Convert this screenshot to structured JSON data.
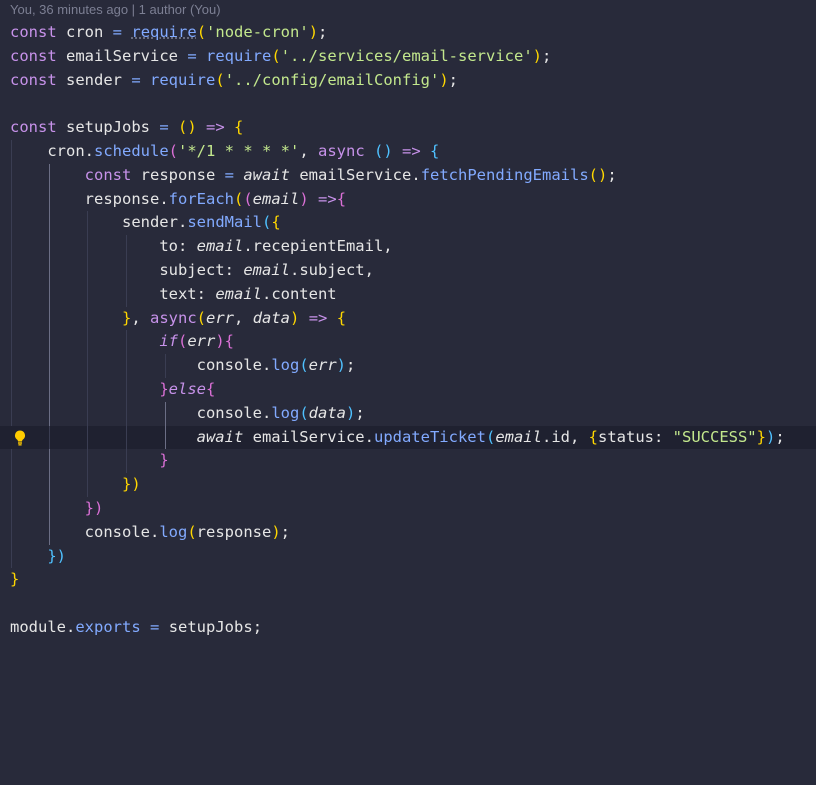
{
  "blame": {
    "text": "You, 36 minutes ago | 1 author (You)"
  },
  "code": {
    "l1": {
      "t1": "const",
      "t2": " cron ",
      "t3": "=",
      "t4": " ",
      "t5": "require",
      "t6": "(",
      "t7": "'node-cron'",
      "t8": ")",
      "t9": ";"
    },
    "l2": {
      "t1": "const",
      "t2": " emailService ",
      "t3": "=",
      "t4": " ",
      "t5": "require",
      "t6": "(",
      "t7": "'../services/email-service'",
      "t8": ")",
      "t9": ";"
    },
    "l3": {
      "t1": "const",
      "t2": " sender ",
      "t3": "=",
      "t4": " ",
      "t5": "require",
      "t6": "(",
      "t7": "'../config/emailConfig'",
      "t8": ")",
      "t9": ";"
    },
    "l5": {
      "t1": "const",
      "t2": " setupJobs ",
      "t3": "=",
      "t4": " ",
      "t5": "()",
      "t6": " ",
      "t7": "=>",
      "t8": " ",
      "t9": "{"
    },
    "l6": {
      "t1": "cron",
      "t2": ".",
      "t3": "schedule",
      "t4": "(",
      "t5": "'*/1 * * * *'",
      "t6": ", ",
      "t7": "async",
      "t8": " ",
      "t9": "()",
      "t10": " ",
      "t11": "=>",
      "t12": " ",
      "t13": "{"
    },
    "l7": {
      "t1": "const",
      "t2": " response ",
      "t3": "=",
      "t4": " ",
      "t5": "await",
      "t6": " emailService",
      "t7": ".",
      "t8": "fetchPendingEmails",
      "t9": "()",
      "t10": ";"
    },
    "l8": {
      "t1": "response",
      "t2": ".",
      "t3": "forEach",
      "t4": "(",
      "t5": "(",
      "t6": "email",
      "t7": ")",
      "t8": " ",
      "t9": "=>",
      "t10": "{"
    },
    "l9": {
      "t1": "sender",
      "t2": ".",
      "t3": "sendMail",
      "t4": "(",
      "t5": "{"
    },
    "l10": {
      "t1": "to: ",
      "t2": "email",
      "t3": ".recepientEmail,",
      "t4": ""
    },
    "l11": {
      "t1": "subject: ",
      "t2": "email",
      "t3": ".subject,",
      "t4": ""
    },
    "l12": {
      "t1": "text: ",
      "t2": "email",
      "t3": ".content"
    },
    "l13": {
      "t1": "}",
      "t2": ", ",
      "t3": "async",
      "t4": "(",
      "t5": "err",
      "t6": ", ",
      "t7": "data",
      "t8": ")",
      "t9": " ",
      "t10": "=>",
      "t11": " ",
      "t12": "{"
    },
    "l14": {
      "t1": "if",
      "t2": "(",
      "t3": "err",
      "t4": ")",
      "t5": "{"
    },
    "l15": {
      "t1": "console",
      "t2": ".",
      "t3": "log",
      "t4": "(",
      "t5": "err",
      "t6": ")",
      "t7": ";"
    },
    "l16": {
      "t1": "}",
      "t2": "else",
      "t3": "{"
    },
    "l17": {
      "t1": "console",
      "t2": ".",
      "t3": "log",
      "t4": "(",
      "t5": "data",
      "t6": ")",
      "t7": ";"
    },
    "l18": {
      "t1": "await",
      "t2": " emailService",
      "t3": ".",
      "t4": "updateTicket",
      "t5": "(",
      "t6": "email",
      "t7": ".id, ",
      "t8": "{",
      "t9": "status: ",
      "t10": "\"SUCCESS\"",
      "t11": "}",
      "t12": ")",
      "t13": ";"
    },
    "l19": {
      "t1": "}"
    },
    "l20": {
      "t1": "})"
    },
    "l21": {
      "t1": "})"
    },
    "l22": {
      "t1": "console",
      "t2": ".",
      "t3": "log",
      "t4": "(",
      "t5": "response",
      "t6": ")",
      "t7": ";"
    },
    "l23": {
      "t1": "})"
    },
    "l24": {
      "t1": "}"
    },
    "l26": {
      "t1": "module",
      "t2": ".",
      "t3": "exports",
      "t4": " ",
      "t5": "=",
      "t6": " setupJobs",
      "t7": ";"
    }
  },
  "icons": {
    "lightbulb": "lightbulb-icon"
  },
  "colors": {
    "background": "#282a3a",
    "current_line": "#1f2130",
    "keyword": "#c792ea",
    "function": "#82aaff",
    "string": "#c3e88d",
    "bracket_gold": "#ffd700",
    "bracket_orchid": "#da70d6",
    "bracket_blue": "#4fc1ff"
  }
}
